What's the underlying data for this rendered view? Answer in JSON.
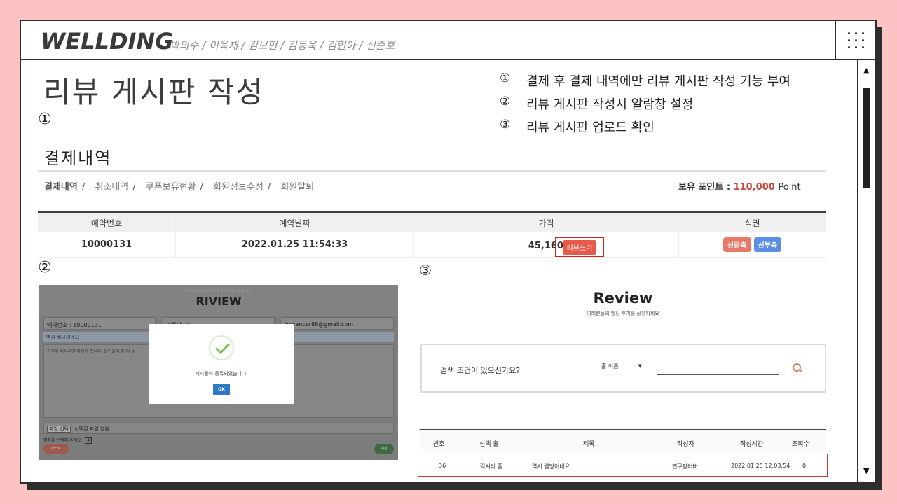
{
  "header": {
    "brand": "WELLDING",
    "members": "박의수 / 이욱채 / 김보현 / 김동욱 / 김현아 / 신준호"
  },
  "page_title": "리뷰 게시판 작성",
  "markers": {
    "m1": "①",
    "m2": "②",
    "m3": "③"
  },
  "notes": [
    {
      "num": "①",
      "text": "결제 후 결제 내역에만 리뷰 게시판 작성 기능 부여"
    },
    {
      "num": "②",
      "text": "리뷰 게시판 작성시 알람창 설정"
    },
    {
      "num": "③",
      "text": "리뷰 게시판 업로드 확인"
    }
  ],
  "payment": {
    "title": "결제내역",
    "subnav": [
      "결제내역",
      "취소내역",
      "쿠폰보유현황",
      "회원정보수정",
      "회원탈퇴"
    ],
    "points_label": "보유 포인트 :",
    "points_value": "110,000",
    "points_unit": "Point",
    "columns": [
      "예약번호",
      "예약날짜",
      "가격",
      "식권"
    ],
    "row": {
      "id": "10000131",
      "date": "2022.01.25 11:54:33",
      "price": "45,160,000원",
      "review_button": "리뷰쓰기",
      "ticket_groom": "신랑측",
      "ticket_bride": "신부측"
    }
  },
  "review_form": {
    "kicker": "SHARING YOUR EXPERIENCES",
    "title": "RIVIEW",
    "reservation": "예약번호 : 10000131",
    "writer": "찐쿠팡러버",
    "email": "hecancer88@gmail.com",
    "subject": "역시 웰딩이네요",
    "content": "가격이 비싸지만 마음에 듭니다. 할인율이 좀 더 높",
    "file_button": "파일 선택",
    "file_status": "선택된 파일 없음",
    "rating_hint": "별점을 선택해 주세요 :",
    "rating_value": "4",
    "list_button": "리스트",
    "save_button": "저장",
    "modal_message": "게시물이 등록되었습니다.",
    "modal_ok": "OK"
  },
  "review_board": {
    "title": "Review",
    "subtitle": "여러분들의 웰딩 후기를 공유하세요",
    "search_label": "검색 조건이 있으신가요?",
    "search_select": "홀 이름",
    "columns": [
      "번호",
      "선택 홀",
      "제목",
      "작성자",
      "작성시간",
      "조회수"
    ],
    "row": {
      "no": "36",
      "hall": "럭셔리 홀",
      "subject": "역시 웰딩이네요",
      "writer": "찐쿠팡러버",
      "time": "2022.01.25 12:03:54",
      "views": "0"
    }
  }
}
